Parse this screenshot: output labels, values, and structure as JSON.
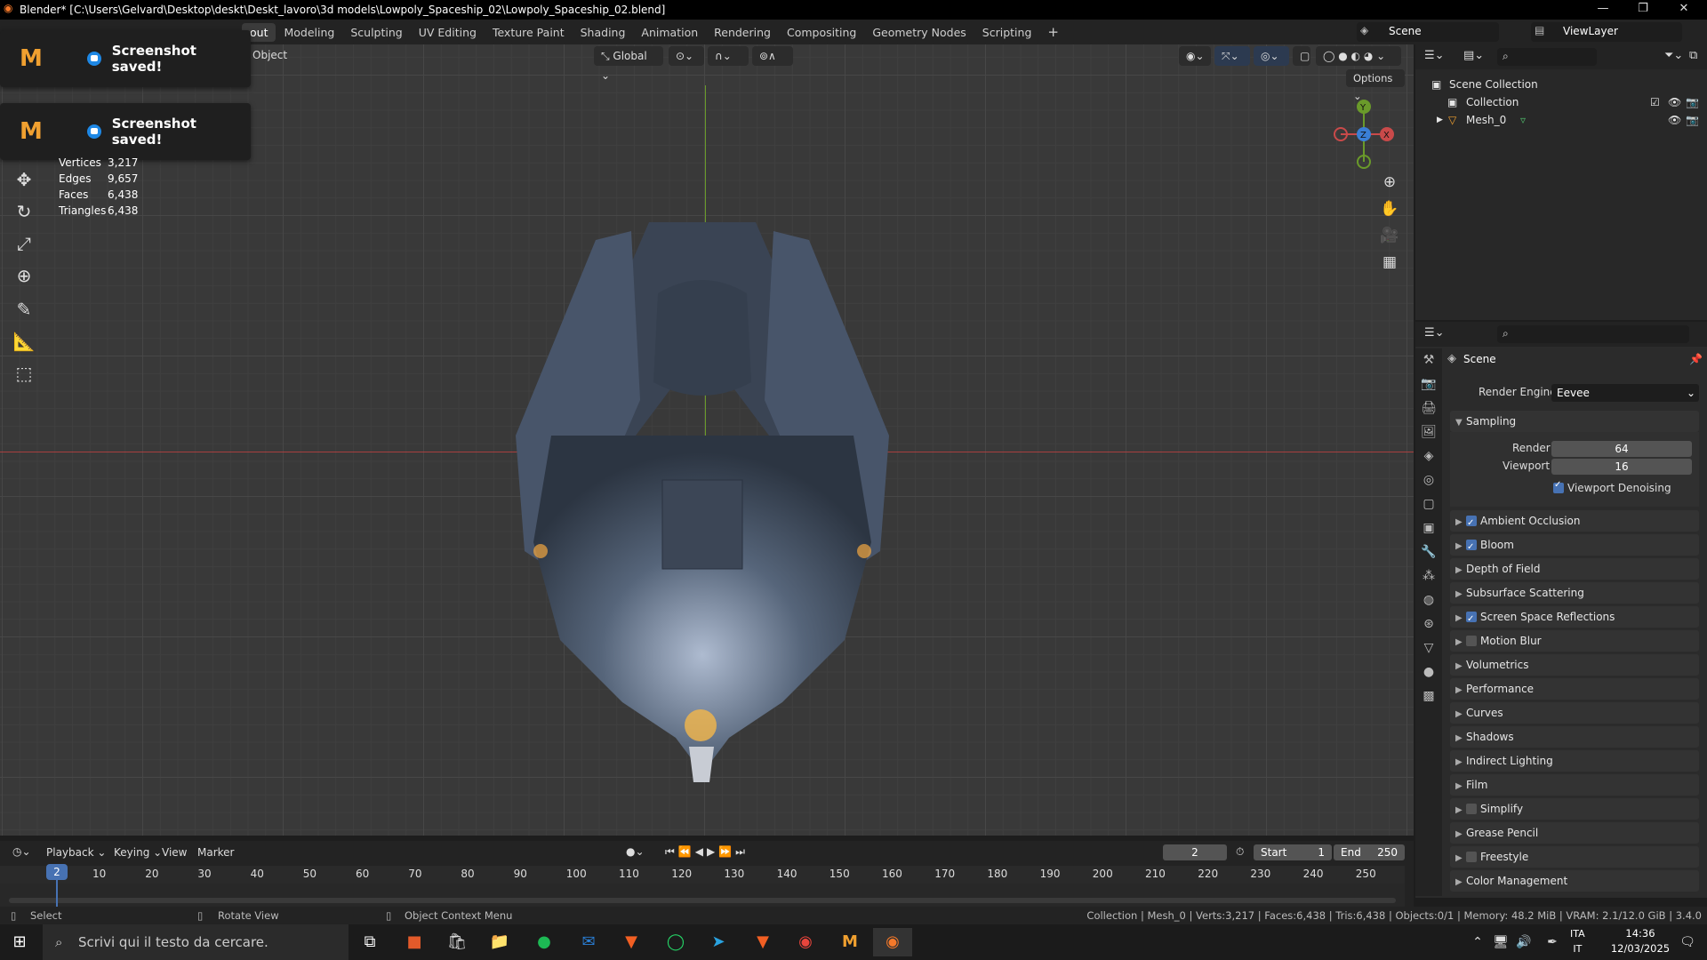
{
  "window": {
    "title": "Blender* [C:\\Users\\Gelvard\\Desktop\\deskt\\Deskt_lavoro\\3d models\\Lowpoly_Spaceship_02\\Lowpoly_Spaceship_02.blend]",
    "minimize": "—",
    "maximize": "❐",
    "close": "✕"
  },
  "topbar": {
    "tabs": [
      "out",
      "Modeling",
      "Sculpting",
      "UV Editing",
      "Texture Paint",
      "Shading",
      "Animation",
      "Rendering",
      "Compositing",
      "Geometry Nodes",
      "Scripting"
    ],
    "add": "+",
    "scene_label": "Scene",
    "viewlayer_label": "ViewLayer"
  },
  "viewport": {
    "object_menu": "Object",
    "transform_orientation": "Global",
    "options": "Options",
    "stats": [
      {
        "k": "Vertices",
        "v": "3,217"
      },
      {
        "k": "Edges",
        "v": "9,657"
      },
      {
        "k": "Faces",
        "v": "6,438"
      },
      {
        "k": "Triangles",
        "v": "6,438"
      }
    ],
    "gizmo": {
      "y": "Y",
      "z": "Z",
      "x": "X"
    },
    "colors": {
      "x_axis": "#c94a4a",
      "y_axis": "#6a9a2a",
      "z_axis": "#3a7fd6"
    }
  },
  "toasts": [
    {
      "message": "Screenshot saved!"
    },
    {
      "message": "Screenshot saved!"
    }
  ],
  "outliner": {
    "scene_collection": "Scene Collection",
    "collection": "Collection",
    "mesh": "Mesh_0"
  },
  "properties": {
    "scene": "Scene",
    "render_engine_label": "Render Engine",
    "render_engine": "Eevee",
    "sampling": "Sampling",
    "render_label": "Render",
    "render_value": "64",
    "viewport_label": "Viewport",
    "viewport_value": "16",
    "viewport_denoising": "Viewport Denoising",
    "sections": [
      {
        "label": "Ambient Occlusion",
        "check": "on"
      },
      {
        "label": "Bloom",
        "check": "on"
      },
      {
        "label": "Depth of Field",
        "check": "none"
      },
      {
        "label": "Subsurface Scattering",
        "check": "none"
      },
      {
        "label": "Screen Space Reflections",
        "check": "on"
      },
      {
        "label": "Motion Blur",
        "check": "off"
      },
      {
        "label": "Volumetrics",
        "check": "none"
      },
      {
        "label": "Performance",
        "check": "none"
      },
      {
        "label": "Curves",
        "check": "none"
      },
      {
        "label": "Shadows",
        "check": "none"
      },
      {
        "label": "Indirect Lighting",
        "check": "none"
      },
      {
        "label": "Film",
        "check": "none"
      },
      {
        "label": "Simplify",
        "check": "off"
      },
      {
        "label": "Grease Pencil",
        "check": "none"
      },
      {
        "label": "Freestyle",
        "check": "off"
      },
      {
        "label": "Color Management",
        "check": "none"
      }
    ]
  },
  "timeline": {
    "playback": "Playback",
    "keying": "Keying",
    "view": "View",
    "marker": "Marker",
    "current_frame": "2",
    "start_label": "Start",
    "start": "1",
    "end_label": "End",
    "end": "250",
    "ticks": [
      "10",
      "20",
      "30",
      "40",
      "50",
      "60",
      "70",
      "80",
      "90",
      "100",
      "110",
      "120",
      "130",
      "140",
      "150",
      "160",
      "170",
      "180",
      "190",
      "200",
      "210",
      "220",
      "230",
      "240",
      "250"
    ]
  },
  "statusbar": {
    "select": "Select",
    "rotate": "Rotate View",
    "context": "Object Context Menu",
    "info": "Collection | Mesh_0 | Verts:3,217 | Faces:6,438 | Tris:6,438 | Objects:0/1 | Memory: 48.2 MiB | VRAM: 2.1/12.0 GiB | 3.4.0"
  },
  "taskbar": {
    "search_placeholder": "Scrivi qui il testo da cercare.",
    "lang1": "ITA",
    "lang2": "IT",
    "time": "14:36",
    "date": "12/03/2025"
  }
}
